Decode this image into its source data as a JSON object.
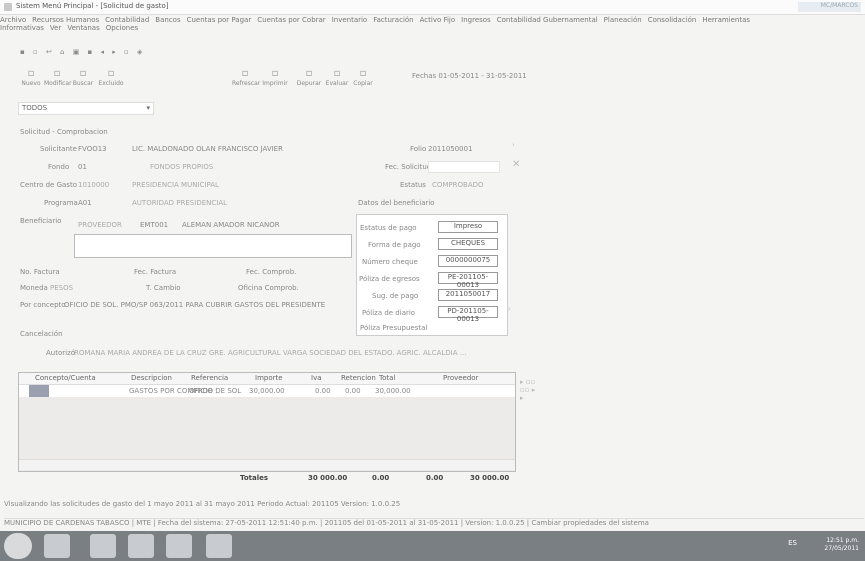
{
  "window": {
    "title": "Sistem Menú Principal - [Solicitud de gasto]",
    "user": "MC/MARCOS"
  },
  "menu": [
    "Archivo",
    "Recursos Humanos",
    "Contabilidad",
    "Bancos",
    "Cuentas por Pagar",
    "Cuentas por Cobrar",
    "Inventario",
    "Facturación",
    "Activo Fijo",
    "Ingresos",
    "Contabilidad Gubernamental",
    "Planeación",
    "Consolidación",
    "Herramientas Informativas",
    "Ver",
    "Ventanas",
    "Opciones"
  ],
  "toolbar": [
    "Nuevo",
    "Modificar",
    "Buscar",
    "Excluido",
    "Refrescar",
    "Imprimir",
    "Depurar",
    "Evaluar",
    "Copiar"
  ],
  "fechas": "Fechas  01-05-2011  -  31-05-2011",
  "todos": "TODOS",
  "form": {
    "section": "Solicitud - Comprobacion",
    "fondo_label": "Fondo",
    "fondo_value": "01",
    "fondo_desc": "FONDOS PROPIOS",
    "solicitante_label": "Solicitante",
    "solicitante_code": "FVOO13",
    "solicitante_name": "LIC. MALDONADO OLAN FRANCISCO JAVIER",
    "centro_label": "Centro de Gasto",
    "centro_value": "1010000",
    "centro_desc": "PRESIDENCIA MUNICIPAL",
    "programa_label": "Programa",
    "programa_value": "A01",
    "programa_desc": "AUTORIDAD PRESIDENCIAL",
    "beneficiario_label": "Beneficiario",
    "beneficiario_type": "PROVEEDOR",
    "beneficiario_code": "EMT001",
    "beneficiario_name": "ALEMAN AMADOR NICANOR",
    "folio_label": "Folio",
    "folio_value": "2011050001",
    "fecsol_label": "Fec. Solicitud",
    "estatus_label": "Estatus",
    "estatus_value": "COMPROBADO",
    "datos_label": "Datos del beneficiario",
    "estatus_pago_label": "Estatus de pago",
    "estatus_pago_value": "Impreso",
    "forma_pago_label": "Forma de pago",
    "forma_pago_value": "CHEQUES",
    "numero_cheque_label": "Número cheque",
    "numero_cheque_value": "0000000075",
    "poliza_egresos_label": "Póliza de egresos",
    "poliza_egresos_value": "PE-201105-00013",
    "sug_pago_label": "Sug. de pago",
    "sug_pago_value": "2011050017",
    "poliza_diario_label": "Póliza de diario",
    "poliza_diario_value": "PD-201105-00013",
    "poliza_presup_label": "Póliza Presupuestal",
    "factura_label": "No. Factura",
    "fecha_factura_label": "Fec. Factura",
    "fecha_comprob_label": "Fec. Comprob.",
    "moneda_label": "Moneda",
    "moneda_value": "PESOS",
    "tipocambio_label": "T. Cambio",
    "oficina_label": "Oficina Comprob.",
    "concepto_label": "Por concepto",
    "concepto_value": "OFICIO DE SOL. PMO/SP 063/2011 PARA CUBRIR GASTOS DEL PRESIDENTE",
    "cancelacion_label": "Cancelación",
    "autorizo_label": "Autorizó",
    "autorizo_value": "ROMANA MARIA ANDREA DE LA CRUZ GRE. AGRICULTURAL VARGA SOCIEDAD DEL ESTADO. AGRIC. ALCALDIA ..."
  },
  "grid": {
    "headers": [
      "Concepto/Cuenta",
      "Descripcion",
      "Referencia",
      "Importe",
      "Iva",
      "Retencion",
      "Total",
      "Proveedor"
    ],
    "rows": [
      {
        "cuenta": "A01",
        "descripcion": "GASTOS POR COMPROB",
        "referencia": "OFICIO DE SOL",
        "importe": "30,000.00",
        "iva": "0.00",
        "retencion": "0.00",
        "total": "30,000.00",
        "proveedor": ""
      }
    ]
  },
  "totals": {
    "label": "Totales",
    "importe": "30 000.00",
    "iva": "0.00",
    "retencion": "0.00",
    "total": "30 000.00"
  },
  "status": {
    "line1": "Visualizando las solicitudes de gasto del 1 mayo 2011 al 31 mayo 2011    Periodo Actual: 201105      Version: 1.0.0.25",
    "line2": "MUNICIPIO DE CARDENAS TABASCO  |  MTE  |  Fecha del sistema: 27-05-2011 12:51:40 p.m.  |  201105 del 01-05-2011 al 31-05-2011  |  Version: 1.0.0.25  |  Cambiar propiedades del sistema"
  },
  "clock": {
    "time": "12:51 p.m.",
    "date": "27/05/2011",
    "lang": "ES"
  }
}
